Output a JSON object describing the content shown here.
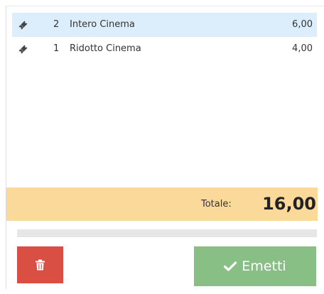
{
  "items": [
    {
      "icon": "ticket-icon",
      "qty": "2",
      "name": "Intero Cinema",
      "price": "6,00",
      "selected": true
    },
    {
      "icon": "ticket-icon",
      "qty": "1",
      "name": "Ridotto Cinema",
      "price": "4,00",
      "selected": false
    }
  ],
  "summary": {
    "total_label": "Totale:",
    "total_value": "16,00"
  },
  "actions": {
    "delete_icon": "trash-icon",
    "emit_icon": "check-icon",
    "emit_label": "Emetti"
  },
  "colors": {
    "selected_row": "#dceefb",
    "total_bar": "#fad99b",
    "delete_button": "#d94f43",
    "emit_button": "#88bf84"
  }
}
